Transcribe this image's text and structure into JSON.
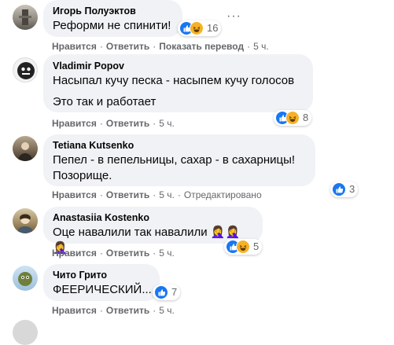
{
  "actions": {
    "like": "Нравится",
    "reply": "Ответить",
    "translate": "Показать перевод",
    "edited": "Отредактировано",
    "more": "···"
  },
  "comments": [
    {
      "author": "Игорь Полуэктов",
      "lines": [
        "Реформи не спинити!"
      ],
      "time": "5 ч.",
      "reactions": "16"
    },
    {
      "author": "Vladimir Popov",
      "lines": [
        "Насыпал кучу песка - насыпем кучу голосов",
        "Это так и работает"
      ],
      "time": "5 ч.",
      "reactions": "8"
    },
    {
      "author": "Tetiana Kutsenko",
      "lines": [
        "Пепел - в пепельницы, сахар - в сахарницы!",
        "Позорище."
      ],
      "time": "5 ч.",
      "reactions": "3"
    },
    {
      "author": "Anastasiia Kostenko",
      "lines": [
        "Оце навалили так навалили 🤦‍♀️🤦‍♀️🤦‍♀️"
      ],
      "time": "5 ч.",
      "reactions": "5"
    },
    {
      "author": "Чито Грито",
      "lines": [
        "ФЕЕРИЧЕСКИЙ..."
      ],
      "time": "5 ч.",
      "reactions": "7"
    }
  ],
  "colors": {
    "like": "#1877f2",
    "haha": "#f7b125",
    "bubble": "#f0f2f5",
    "meta": "#65676b"
  }
}
